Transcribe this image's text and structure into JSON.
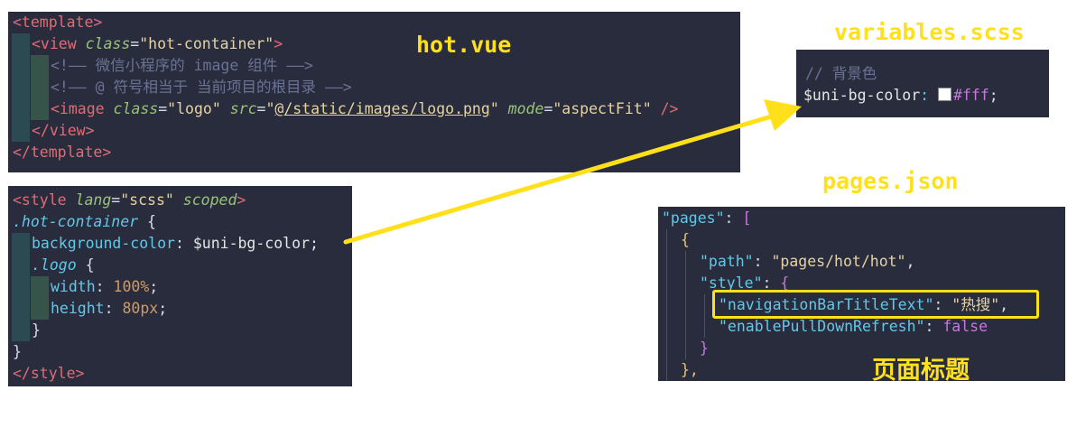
{
  "hot_vue": {
    "label": "hot.vue",
    "lines": {
      "l1": "<template>",
      "l2_tag": "<view",
      "l2_attr": "class",
      "l2_eq": "=",
      "l2_val": "\"hot-container\"",
      "l2_end": ">",
      "l3": "<!—— 微信小程序的 image 组件 ——>",
      "l4": "<!—— @ 符号相当于 当前项目的根目录 ——>",
      "l5_tag": "<image",
      "l5_a1": "class",
      "l5_v1": "\"logo\"",
      "l5_a2": "src",
      "l5_v2a": "\"",
      "l5_v2b": "@/static/images/logo.png",
      "l5_v2c": "\"",
      "l5_a3": "mode",
      "l5_v3": "\"aspectFit\"",
      "l5_end": "/>",
      "l6": "</view>",
      "l7": "</template>"
    }
  },
  "style_block": {
    "lines": {
      "l1_tag": "<style",
      "l1_a1": "lang",
      "l1_v1": "\"scss\"",
      "l1_a2": "scoped",
      "l1_end": ">",
      "l2_sel": ".hot-container",
      "l2_brace": "{",
      "l3_prop": "background-color",
      "l3_val": "$uni-bg-color;",
      "l4_sel": ".logo",
      "l4_brace": "{",
      "l5_prop": "width",
      "l5_val": "100%",
      "l6_prop": "height",
      "l6_val": "80px",
      "l7": "}",
      "l8": "}",
      "l9": "</style>"
    }
  },
  "variables_scss": {
    "label": "variables.scss",
    "comment": "// 背景色",
    "var_name": "$uni-bg-color",
    "var_value": "#fff"
  },
  "pages_json": {
    "label": "pages.json",
    "lines": {
      "l1_key": "\"pages\"",
      "l1_rest": "[",
      "l2": "{",
      "l3_key": "\"path\"",
      "l3_val": "\"pages/hot/hot\"",
      "l4_key": "\"style\"",
      "l4_brace": "{",
      "l5_key": "\"navigationBarTitleText\"",
      "l5_val": "\"热搜\"",
      "l6_key": "\"enablePullDownRefresh\"",
      "l6_val": "false",
      "l7": "}",
      "l8": "},"
    },
    "annotation": "页面标题"
  },
  "colors": {
    "accent": "#ffe01b",
    "editor_bg": "#282c3c"
  }
}
